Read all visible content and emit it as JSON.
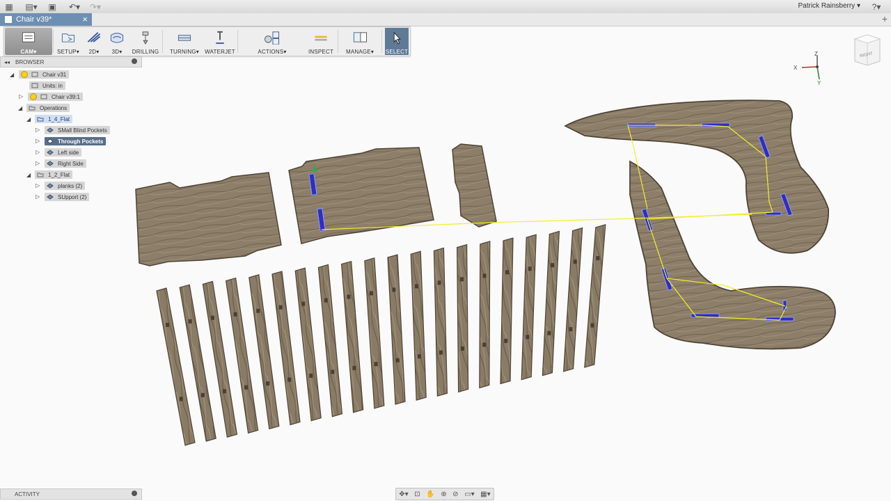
{
  "app": {
    "doc_tab": "Chair v39*",
    "user": "Patrick Rainsberry",
    "help_icon": "help-icon"
  },
  "ribbon": [
    {
      "id": "cam",
      "label": "CAM▾",
      "icon": "cam-workspace-icon"
    },
    {
      "id": "setup",
      "label": "SETUP▾",
      "icon": "setup-icon"
    },
    {
      "id": "2d",
      "label": "2D▾",
      "icon": "2d-toolpath-icon"
    },
    {
      "id": "3d",
      "label": "3D▾",
      "icon": "3d-toolpath-icon"
    },
    {
      "id": "drilling",
      "label": "DRILLING",
      "icon": "drill-icon"
    },
    {
      "id": "turning",
      "label": "TURNING▾",
      "icon": "turning-icon"
    },
    {
      "id": "waterjet",
      "label": "WATERJET",
      "icon": "waterjet-icon"
    },
    {
      "id": "actions",
      "label": "ACTIONS▾",
      "icon": "simulate-icon"
    },
    {
      "id": "inspect",
      "label": "INSPECT",
      "icon": "measure-icon"
    },
    {
      "id": "manage",
      "label": "MANAGE▾",
      "icon": "tool-library-icon"
    },
    {
      "id": "select",
      "label": "SELECT",
      "icon": "select-cursor-icon"
    }
  ],
  "browser": {
    "title": "BROWSER",
    "root": "Chair v31",
    "units": "Units: in",
    "component": "Chair v39:1",
    "operations": "Operations",
    "setup1": "1_4_Flat",
    "ops1": [
      "SMall Blind Pockets",
      "Through Pockets",
      "Left side",
      "Right Side"
    ],
    "setup2": "1_2_Flat",
    "ops2": [
      "planks (2)",
      "SUpport (2)"
    ]
  },
  "activity": {
    "title": "ACTIVITY"
  },
  "viewcube": {
    "label": "RIGHT"
  },
  "triad": {
    "x": "X",
    "y": "Y",
    "z": "Z"
  },
  "colors": {
    "wood": "#8a7b66",
    "wood_dark": "#5f5344",
    "toolpath": "#2e2fbf",
    "rapid": "#f2ee2a",
    "ribbon_active": "#5f7a96",
    "tab": "#6d8fb2"
  }
}
